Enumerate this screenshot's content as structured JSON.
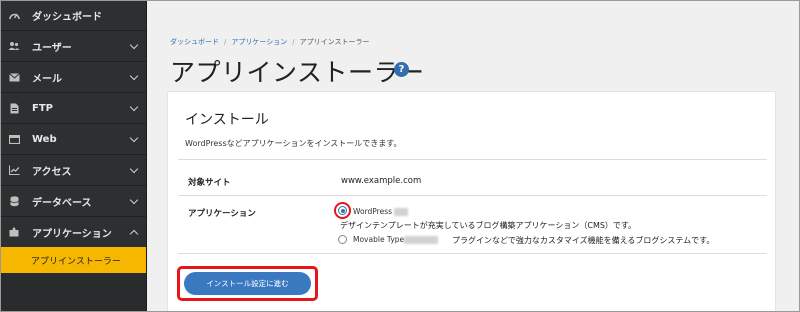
{
  "sidebar": {
    "items": [
      {
        "label": "ダッシュボード",
        "icon": "gauge-icon",
        "has_chevron": false
      },
      {
        "label": "ユーザー",
        "icon": "users-icon",
        "has_chevron": true
      },
      {
        "label": "メール",
        "icon": "envelope-icon",
        "has_chevron": true
      },
      {
        "label": "FTP",
        "icon": "file-icon",
        "has_chevron": true
      },
      {
        "label": "Web",
        "icon": "window-icon",
        "has_chevron": true
      },
      {
        "label": "アクセス",
        "icon": "line-chart-icon",
        "has_chevron": true
      },
      {
        "label": "データベース",
        "icon": "database-icon",
        "has_chevron": true
      },
      {
        "label": "アプリケーション",
        "icon": "puzzle-icon",
        "has_chevron": true
      }
    ],
    "active_sub_item": "アプリインストーラー",
    "active_color": "#f5b700"
  },
  "breadcrumb": {
    "items": [
      "ダッシュボード",
      "アプリケーション",
      "アプリインストーラー"
    ]
  },
  "page": {
    "title": "アプリインストーラー",
    "help_icon_glyph": "?"
  },
  "card": {
    "title": "インストール",
    "description": "WordPressなどアプリケーションをインストールできます。",
    "target_site_label": "対象サイト",
    "target_site_value": "www.example.com",
    "application_label": "アプリケーション",
    "options": [
      {
        "name": "WordPress",
        "selected": true,
        "description": "デザインテンプレートが充実しているブログ構築アプリケーション（CMS）です。"
      },
      {
        "name": "Movable Type",
        "selected": false,
        "description": "プラグインなどで強力なカスタマイズ機能を備えるブログシステムです。"
      }
    ],
    "submit_label": "インストール設定に進む"
  },
  "colors": {
    "accent": "#3a79c0",
    "highlight": "#e8151b",
    "sidebar_bg": "#2d2f31"
  }
}
